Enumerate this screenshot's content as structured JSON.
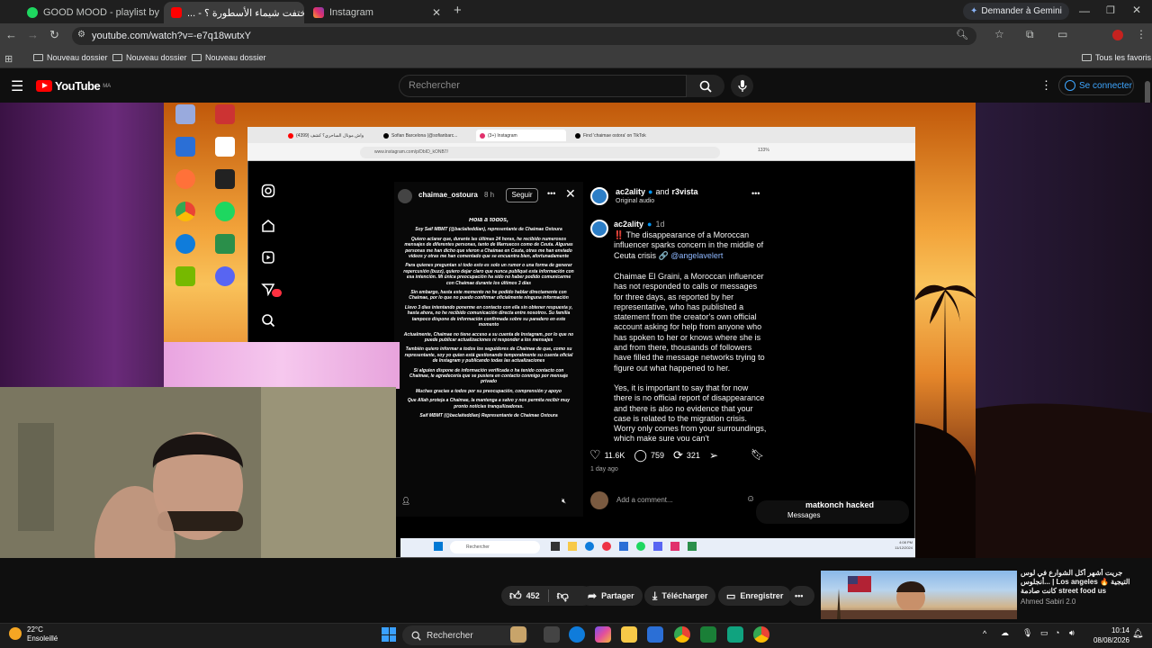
{
  "browser": {
    "tabs": [
      {
        "label": "GOOD MOOD - playlist by Csa",
        "icon": "spotify-icon",
        "active": false
      },
      {
        "label": "أين إختفت شيماء الأسطورة ؟ - ...",
        "icon": "youtube-icon",
        "active": true
      },
      {
        "label": "Instagram",
        "icon": "instagram-icon",
        "active": false
      }
    ],
    "new_tab": "+",
    "gemini_button": "Demander à Gemini",
    "url": "youtube.com/watch?v=-e7q18wutxY",
    "bookmarks": [
      "Nouveau dossier",
      "Nouveau dossier",
      "Nouveau dossier"
    ],
    "all_favorites": "Tous les favoris"
  },
  "youtube": {
    "logo_text": "YouTube",
    "region": "MA",
    "search_placeholder": "Rechercher",
    "signin_label": "Se connecter",
    "like_count": "452",
    "share_label": "Partager",
    "download_label": "Télécharger",
    "save_label": "Enregistrer",
    "more_label": "•••",
    "recommendation": {
      "title": "جريت أشهر أكل الشوارع في لوس أنجلوس... | Los angeles 🔥 التيجية كانت صادمة street food us",
      "channel": "Ahmed Sabiri 2.0"
    }
  },
  "inner_browser": {
    "tabs": [
      "واش مونال الساحري؟ كشف (4399)",
      "Sofian Barcelona (@sofianbarc...",
      "(3+) Instagram",
      "Find 'chaimae ostora' on TikTok"
    ],
    "url": "www.instagram.com/p/DbID_kONB7/",
    "zoom": "133%",
    "taskbar_search": "Rechercher",
    "clock_time": "4:08 PM",
    "clock_date": "11/12/2024"
  },
  "story": {
    "username": "chaimae_ostoura",
    "time": "8 h",
    "follow_label": "Seguir",
    "heading": "Hola a todos,",
    "paragraphs": [
      "Soy Saif MBMT (@baclaiteddian), representante de Chaimae Ostoura",
      "Quiero aclarar que, durante las últimas 24 horas, he recibido numerosos mensajes de diferentes personas, tanto de Marruecos como de Ceuta. Algunas personas me han dicho que vieron a Chaimae en Ceuta, otras me han enviado videos y otras me han comentado que se encuentra bien, afortunadamente",
      "Para quienes preguntan si todo esto es solo un rumor o una forma de generar repercusión (buzz), quiero dejar claro que nunca publiqué esta información con esa intención. Mi única preocupación ha sido no haber podido comunicarme con Chaimae durante los últimos 3 días",
      "Sin embargo, hasta este momento no he podido hablar directamente con Chaimae, por lo que no puedo confirmar oficialmente ninguna información",
      "Llevo 3 días intentando ponerme en contacto con ella sin obtener respuesta y, hasta ahora, no he recibido comunicación directa entre nosotros. Su familia tampoco dispone de información confirmada sobre su paradero en este momento",
      "Actualmente, Chaimae no tiene acceso a su cuenta de Instagram, por lo que no puede publicar actualizaciones ni responder a los mensajes",
      "También quiero informar a todos los seguidores de Chaimae de que, como su representante, soy yo quien está gestionando temporalmente su cuenta oficial de Instagram y publicando todas las actualizaciones",
      "Si alguien dispone de información verificada o ha tenido contacto con Chaimae, le agradecería que se pusiera en contacto conmigo por mensaje privado",
      "Muchas gracias a todos por su preocupación, comprensión y apoyo",
      "Que Allah proteja a Chaimae, la mantenga a salvo y nos permita recibir muy pronto noticias tranquilizadoras.",
      "Saif MBMT (@baclaiteddian) Representante de Chaimae Ostoura"
    ]
  },
  "post": {
    "header_user": "ac2ality",
    "header_and": "and",
    "header_user2": "r3vista",
    "audio": "Original audio",
    "comment_user": "ac2ality",
    "comment_time": "1d",
    "caption_p1": "‼️ The disappearance of a Moroccan influencer sparks concern in the middle of Ceuta crisis 🔗",
    "mention": "@angelavelert",
    "caption_p2": "Chaimae El Graini, a Moroccan influencer has not responded to calls or messages for three days, as reported by her representative, who has published a statement from the creator's own official account asking for help from anyone who has spoken to her or knows where she is and from there, thousands of followers have filled the message networks trying to figure out what happened to her.",
    "caption_p3": "Yes, it is important to say that for now there is no official report of disappearance and there is also no evidence that your case is related to the migration crisis. Worry only comes from your surroundings, which make sure you can't",
    "likes": "11.6K",
    "comments": "759",
    "reposts": "321",
    "date": "1 day ago",
    "add_comment": "Add a comment...",
    "overlay_names": "matkonch hacked",
    "overlay_messages": "Messages"
  },
  "system": {
    "weather_temp": "22°C",
    "weather_desc": "Ensoleillé",
    "search_label": "Rechercher",
    "time": "10:14",
    "date": "08/08/2026"
  }
}
